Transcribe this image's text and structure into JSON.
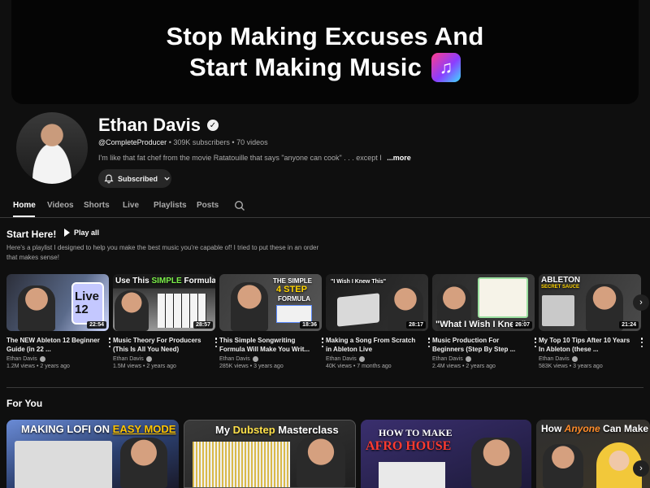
{
  "banner": {
    "line1": "Stop Making Excuses And",
    "line2": "Start Making Music",
    "icon": "music-note-icon"
  },
  "channel": {
    "name": "Ethan Davis",
    "handle": "@CompleteProducer",
    "subscribers": "309K subscribers",
    "videos": "70 videos",
    "description": "I'm like that fat chef from the movie Ratatouille that says \"anyone can cook\" . . . except I",
    "more": "...more",
    "subscribe_label": "Subscribed"
  },
  "tabs": [
    {
      "label": "Home"
    },
    {
      "label": "Videos"
    },
    {
      "label": "Shorts"
    },
    {
      "label": "Live"
    },
    {
      "label": "Playlists"
    },
    {
      "label": "Posts"
    }
  ],
  "start_here": {
    "title": "Start Here!",
    "play_all": "Play all",
    "description": "Here's a playlist I designed to help you make the best music you're capable of! I tried to put these in an order that makes sense!"
  },
  "videos": [
    {
      "title": "The NEW Ableton 12 Beginner Guide (in 22 ...",
      "channel": "Ethan Davis",
      "stats": "1.2M views • 2 years ago",
      "duration": "22:54",
      "thumb_text": "Live 12"
    },
    {
      "title": "Music Theory For Producers (This Is All You Need)",
      "channel": "Ethan Davis",
      "stats": "1.5M views • 2 years ago",
      "duration": "28:57",
      "thumb_text_a": "Use This ",
      "thumb_text_b": "SIMPLE",
      "thumb_text_c": " Formula"
    },
    {
      "title": "This Simple Songwriting Formula Will Make You Writ...",
      "channel": "Ethan Davis",
      "stats": "285K views • 3 years ago",
      "duration": "18:36",
      "thumb_text_a": "THE SIMPLE",
      "thumb_text_b": "4 STEP",
      "thumb_text_c": "FORMULA"
    },
    {
      "title": "Making a Song From Scratch in Ableton Live",
      "channel": "Ethan Davis",
      "stats": "40K views • 7 months ago",
      "duration": "28:17",
      "thumb_text": "\"I Wish I Knew This\""
    },
    {
      "title": "Music Production For Beginners (Step By Step ...",
      "channel": "Ethan Davis",
      "stats": "2.4M views • 2 years ago",
      "duration": "26:07",
      "thumb_text": "\"What I Wish I Knew\""
    },
    {
      "title": "My Top 10 Tips After 10 Years In Ableton (these ...",
      "channel": "Ethan Davis",
      "stats": "583K views • 3 years ago",
      "duration": "21:24",
      "thumb_text_a": "ABLETON",
      "thumb_text_b": "SECRET SAUCE"
    }
  ],
  "for_you": {
    "title": "For You",
    "cards": [
      {
        "text_a": "MAKING LOFI ON ",
        "text_b": "EASY MODE"
      },
      {
        "text_a": "My ",
        "text_b": "Dubstep",
        "text_c": " Masterclass"
      },
      {
        "text_a": "HOW TO MAKE",
        "text_b": "AFRO HOUSE"
      },
      {
        "text_a": "How ",
        "text_b": "Anyone",
        "text_c": " Can Make"
      }
    ]
  },
  "colors": {
    "background": "#0f0f0f",
    "text_secondary": "#aaaaaa",
    "simple_green": "#7cf04a",
    "step_yellow": "#ffd400",
    "easy_yellow": "#ffc400",
    "dubstep_yellow": "#ffe14a",
    "afro_red": "#ff3b30"
  }
}
